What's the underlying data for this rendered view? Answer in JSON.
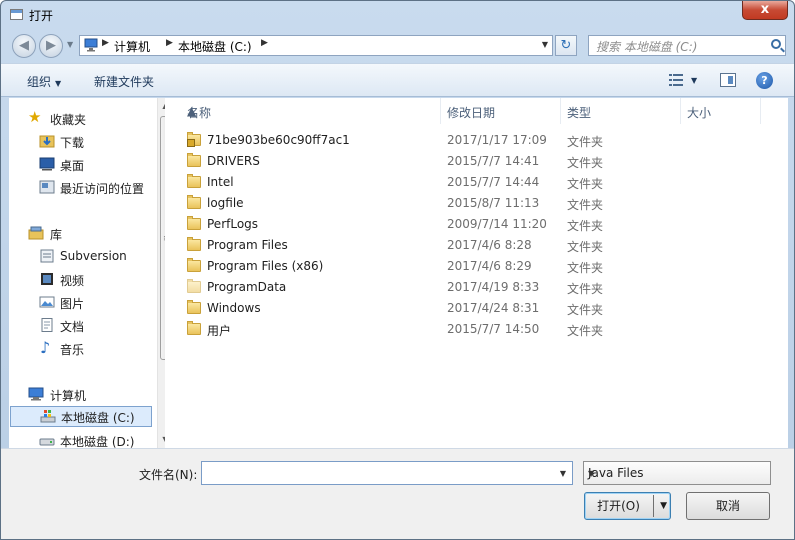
{
  "window": {
    "title": "打开",
    "close_glyph": "x"
  },
  "address": {
    "crumbs": [
      "计算机",
      "本地磁盘 (C:)"
    ]
  },
  "search": {
    "placeholder": "搜索 本地磁盘 (C:)"
  },
  "toolbar": {
    "organize": "组织",
    "new_folder": "新建文件夹"
  },
  "nav": {
    "favorites_header": "收藏夹",
    "favorites": [
      "下载",
      "桌面",
      "最近访问的位置"
    ],
    "libraries_header": "库",
    "libraries": [
      "Subversion",
      "视频",
      "图片",
      "文档",
      "音乐"
    ],
    "computer_header": "计算机",
    "drives": [
      "本地磁盘 (C:)",
      "本地磁盘 (D:)"
    ],
    "selected": "本地磁盘 (C:)"
  },
  "columns": {
    "name": "名称",
    "date": "修改日期",
    "type": "类型",
    "size": "大小"
  },
  "files": [
    {
      "name": "71be903be60c90ff7ac1",
      "date": "2017/1/17 17:09",
      "type": "文件夹",
      "locked": true
    },
    {
      "name": "DRIVERS",
      "date": "2015/7/7 14:41",
      "type": "文件夹"
    },
    {
      "name": "Intel",
      "date": "2015/7/7 14:44",
      "type": "文件夹"
    },
    {
      "name": "logfile",
      "date": "2015/8/7 11:13",
      "type": "文件夹"
    },
    {
      "name": "PerfLogs",
      "date": "2009/7/14 11:20",
      "type": "文件夹"
    },
    {
      "name": "Program Files",
      "date": "2017/4/6 8:28",
      "type": "文件夹"
    },
    {
      "name": "Program Files (x86)",
      "date": "2017/4/6 8:29",
      "type": "文件夹"
    },
    {
      "name": "ProgramData",
      "date": "2017/4/19 8:33",
      "type": "文件夹"
    },
    {
      "name": "Windows",
      "date": "2017/4/24 8:31",
      "type": "文件夹"
    },
    {
      "name": "用户",
      "date": "2015/7/7 14:50",
      "type": "文件夹"
    }
  ],
  "bottom": {
    "filename_label": "文件名(N):",
    "filename_value": "",
    "filetype": "Java Files",
    "open_label": "打开(O)",
    "cancel_label": "取消"
  }
}
